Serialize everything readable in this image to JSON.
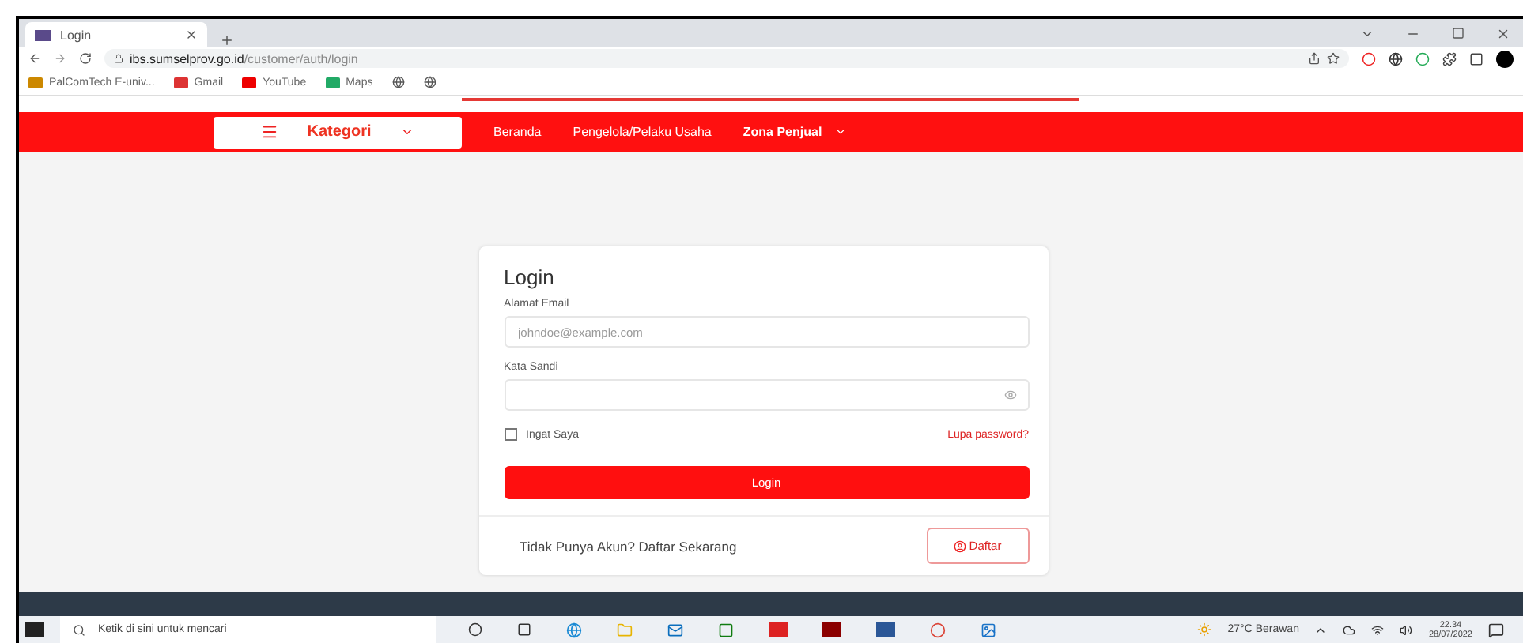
{
  "browser": {
    "tab": {
      "title": "Login",
      "selected": true
    },
    "address": {
      "host": "ibs.sumselprov.go.id",
      "path": "/customer/auth/login"
    },
    "bookmarks": [
      {
        "label": "PalComTech E-univ..."
      },
      {
        "label": "Gmail"
      },
      {
        "label": "YouTube"
      },
      {
        "label": "Maps"
      }
    ]
  },
  "nav": {
    "category": {
      "label": "Kategori"
    },
    "links": [
      {
        "label": "Beranda",
        "bold": false,
        "dropdown": false
      },
      {
        "label": "Pengelola/Pelaku Usaha",
        "bold": false,
        "dropdown": false
      },
      {
        "label": "Zona Penjual",
        "bold": true,
        "dropdown": true
      }
    ]
  },
  "login": {
    "title": "Login",
    "email": {
      "label": "Alamat Email",
      "placeholder": "johndoe@example.com"
    },
    "password": {
      "label": "Kata Sandi"
    },
    "remember": {
      "label": "Ingat Saya",
      "checked": false
    },
    "forgot": "Lupa password?",
    "submit": "Login",
    "signup_text": "Tidak Punya Akun? Daftar Sekarang",
    "signup_button": "Daftar"
  },
  "taskbar": {
    "search_placeholder": "Ketik di sini untuk mencari",
    "weather": "27°C  Berawan",
    "time": "22.34",
    "date": "28/07/2022"
  }
}
